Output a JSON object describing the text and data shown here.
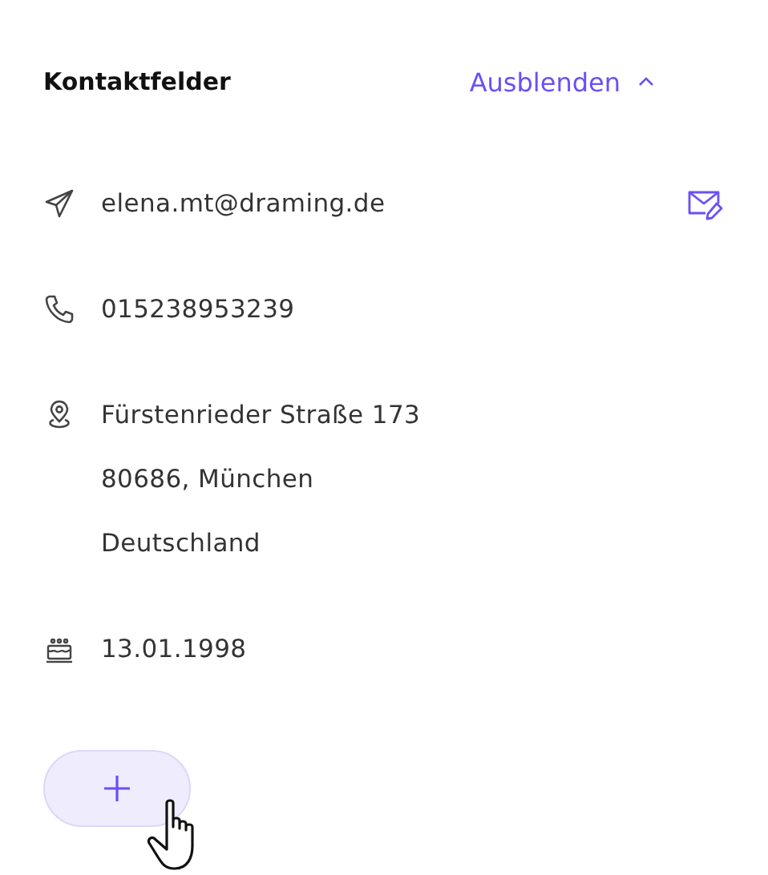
{
  "section": {
    "title": "Kontaktfelder",
    "toggle": {
      "label": "Ausblenden",
      "expanded": true
    }
  },
  "fields": [
    {
      "kind": "email",
      "lines": [
        "elena.mt@draming.de"
      ]
    },
    {
      "kind": "phone",
      "lines": [
        "015238953239"
      ]
    },
    {
      "kind": "address",
      "lines": [
        "Fürstenrieder Straße 173",
        "80686, München",
        "Deutschland"
      ]
    },
    {
      "kind": "birthday",
      "lines": [
        "13.01.1998"
      ]
    }
  ]
}
